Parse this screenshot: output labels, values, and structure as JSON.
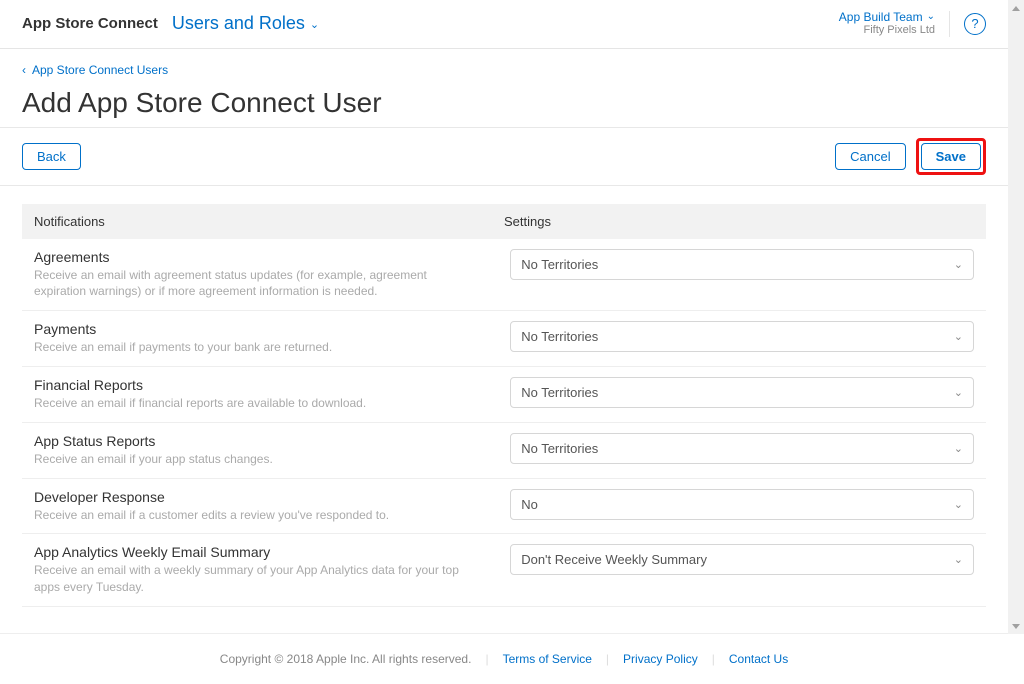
{
  "header": {
    "app_title": "App Store Connect",
    "section": "Users and Roles",
    "team_name": "App Build Team",
    "team_org": "Fifty Pixels Ltd"
  },
  "subheader": {
    "breadcrumb": "App Store Connect Users",
    "title": "Add App Store Connect User"
  },
  "toolbar": {
    "back": "Back",
    "cancel": "Cancel",
    "save": "Save"
  },
  "columns": {
    "notifications": "Notifications",
    "settings": "Settings"
  },
  "rows": [
    {
      "title": "Agreements",
      "desc": "Receive an email with agreement status updates (for example, agreement expiration warnings) or if more agreement information is needed.",
      "value": "No Territories"
    },
    {
      "title": "Payments",
      "desc": "Receive an email if payments to your bank are returned.",
      "value": "No Territories"
    },
    {
      "title": "Financial Reports",
      "desc": "Receive an email if financial reports are available to download.",
      "value": "No Territories"
    },
    {
      "title": "App Status Reports",
      "desc": "Receive an email if your app status changes.",
      "value": "No Territories"
    },
    {
      "title": "Developer Response",
      "desc": "Receive an email if a customer edits a review you've responded to.",
      "value": "No"
    },
    {
      "title": "App Analytics Weekly Email Summary",
      "desc": "Receive an email with a weekly summary of your App Analytics data for your top apps every Tuesday.",
      "value": "Don't Receive Weekly Summary"
    }
  ],
  "footer": {
    "copyright": "Copyright © 2018 Apple Inc. All rights reserved.",
    "terms": "Terms of Service",
    "privacy": "Privacy Policy",
    "contact": "Contact Us"
  }
}
